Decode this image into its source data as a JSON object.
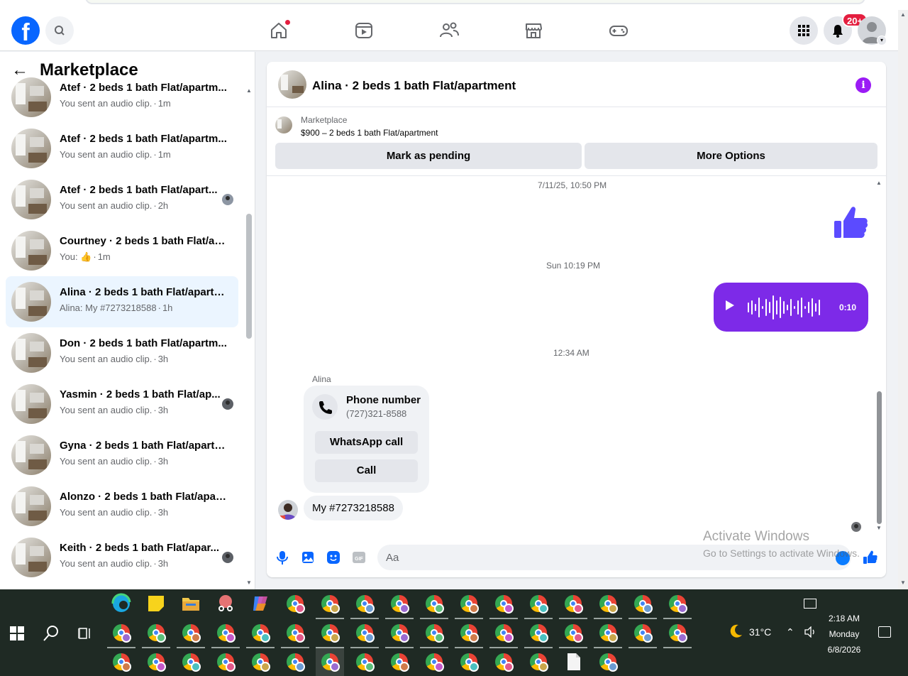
{
  "nav": {
    "logo_letter": "f",
    "notifications_badge": "20+",
    "brand_color": "#0866ff"
  },
  "sidebar": {
    "title": "Marketplace",
    "conversations": [
      {
        "title": "Atef · 2 beds 1 bath Flat/apartm...",
        "preview": "You sent an audio clip.",
        "time": "1m",
        "seen": false,
        "active": false
      },
      {
        "title": "Atef · 2 beds 1 bath Flat/apartm...",
        "preview": "You sent an audio clip.",
        "time": "1m",
        "seen": false,
        "active": false
      },
      {
        "title": "Atef · 2 beds 1 bath Flat/apart...",
        "preview": "You sent an audio clip.",
        "time": "2h",
        "seen": true,
        "active": false
      },
      {
        "title": "Courtney · 2 beds 1 bath Flat/ap...",
        "preview": "You: 👍",
        "time": "1m",
        "seen": false,
        "active": false
      },
      {
        "title": "Alina · 2 beds 1 bath Flat/apartm...",
        "preview": "Alina: My #7273218588",
        "time": "1h",
        "seen": false,
        "active": true
      },
      {
        "title": "Don · 2 beds 1 bath Flat/apartm...",
        "preview": "You sent an audio clip.",
        "time": "3h",
        "seen": false,
        "active": false
      },
      {
        "title": "Yasmin · 2 beds 1 bath Flat/ap...",
        "preview": "You sent an audio clip.",
        "time": "3h",
        "seen": true,
        "active": false
      },
      {
        "title": "Gyna · 2 beds 1 bath Flat/apartm...",
        "preview": "You sent an audio clip.",
        "time": "3h",
        "seen": false,
        "active": false
      },
      {
        "title": "Alonzo · 2 beds 1 bath Flat/apart...",
        "preview": "You sent an audio clip.",
        "time": "3h",
        "seen": false,
        "active": false
      },
      {
        "title": "Keith · 2 beds 1 bath Flat/apar...",
        "preview": "You sent an audio clip.",
        "time": "3h",
        "seen": true,
        "active": false
      }
    ]
  },
  "chat": {
    "title": "Alina · 2 beds 1 bath Flat/apartment",
    "info_label": "i",
    "listing": {
      "source": "Marketplace",
      "summary": "$900 – 2 beds 1 bath Flat/apartment",
      "pending_button": "Mark as pending",
      "more_button": "More Options"
    },
    "timestamps": [
      "7/11/25, 10:50 PM",
      "Sun 10:19 PM",
      "12:34 AM"
    ],
    "audio_duration": "0:10",
    "audio_color": "#7d2ae8",
    "sender": "Alina",
    "phone_card": {
      "title": "Phone number",
      "number": "(727)321-8588",
      "whatsapp_button": "WhatsApp call",
      "call_button": "Call"
    },
    "last_message": "My #7273218588",
    "composer_placeholder": "Aa"
  },
  "watermark": {
    "line1": "Activate Windows",
    "line2": "Go to Settings to activate Windows."
  },
  "taskbar": {
    "temperature": "31°C",
    "time": "2:18 AM",
    "day": "Monday",
    "date": "6/8/2026"
  }
}
